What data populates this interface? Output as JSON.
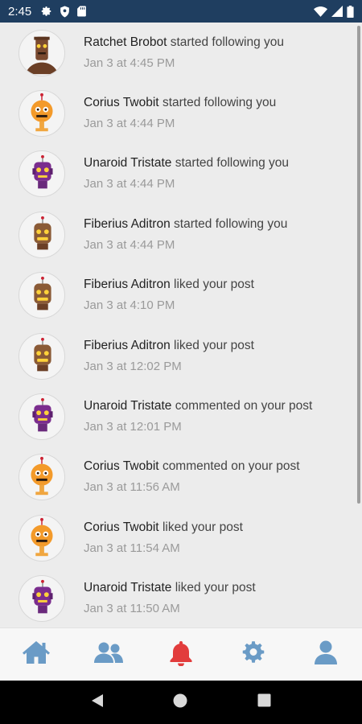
{
  "status_bar": {
    "time": "2:45",
    "left_icons": [
      "gear-icon",
      "shield-icon",
      "sd-card-icon"
    ],
    "right_icons": [
      "wifi-icon",
      "signal-icon",
      "battery-icon"
    ]
  },
  "notifications": [
    {
      "user": "Ratchet Brobot",
      "action": "started following you",
      "time": "Jan 3 at 4:45 PM",
      "avatar": "robot-brown-tall",
      "color": "#7a4a30"
    },
    {
      "user": "Corius Twobit",
      "action": "started following you",
      "time": "Jan 3 at 4:44 PM",
      "avatar": "robot-orange",
      "color": "#f39a2a"
    },
    {
      "user": "Unaroid Tristate",
      "action": "started following you",
      "time": "Jan 3 at 4:44 PM",
      "avatar": "robot-purple",
      "color": "#7b2d8e"
    },
    {
      "user": "Fiberius Aditron",
      "action": "started following you",
      "time": "Jan 3 at 4:44 PM",
      "avatar": "robot-brown",
      "color": "#8a5a36"
    },
    {
      "user": "Fiberius Aditron",
      "action": "liked your post",
      "time": "Jan 3 at 4:10 PM",
      "avatar": "robot-brown",
      "color": "#8a5a36"
    },
    {
      "user": "Fiberius Aditron",
      "action": "liked your post",
      "time": "Jan 3 at 12:02 PM",
      "avatar": "robot-brown",
      "color": "#8a5a36"
    },
    {
      "user": "Unaroid Tristate",
      "action": "commented on your post",
      "time": "Jan 3 at 12:01 PM",
      "avatar": "robot-purple",
      "color": "#7b2d8e"
    },
    {
      "user": "Corius Twobit",
      "action": "commented on your post",
      "time": "Jan 3 at 11:56 AM",
      "avatar": "robot-orange",
      "color": "#f39a2a"
    },
    {
      "user": "Corius Twobit",
      "action": "liked your post",
      "time": "Jan 3 at 11:54 AM",
      "avatar": "robot-orange",
      "color": "#f39a2a"
    },
    {
      "user": "Unaroid Tristate",
      "action": "liked your post",
      "time": "Jan 3 at 11:50 AM",
      "avatar": "robot-purple",
      "color": "#7b2d8e"
    }
  ],
  "bottom_nav": {
    "items": [
      {
        "icon": "home-icon",
        "active": false
      },
      {
        "icon": "friends-icon",
        "active": false
      },
      {
        "icon": "bell-icon",
        "active": true
      },
      {
        "icon": "settings-gear-icon",
        "active": false
      },
      {
        "icon": "profile-icon",
        "active": false
      }
    ],
    "inactive_color": "#6a9bc6",
    "active_color": "#e23c3c"
  },
  "system_nav": [
    "back-icon",
    "home-circle-icon",
    "recents-icon"
  ]
}
